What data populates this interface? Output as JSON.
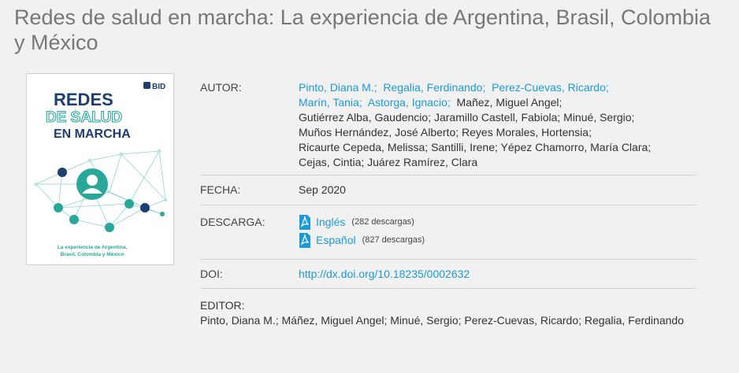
{
  "page": {
    "title": "Redes de salud en marcha: La experiencia de Argentina, Brasil, Colombia y México"
  },
  "cover": {
    "brand": "BID",
    "title_lines": [
      "REDES",
      "DE SALUD",
      "EN MARCHA"
    ],
    "subtitle_lines": [
      "La experiencia de Argentina,",
      "Brasil, Colombia y México"
    ],
    "colors": {
      "navy": "#1d3e6e",
      "teal": "#2aa79b",
      "network": "#8fd3cf"
    }
  },
  "autor": {
    "label": "AUTOR:",
    "linked": [
      "Pinto, Diana M.;",
      "Regalia, Ferdinando;",
      "Perez-Cuevas, Ricardo;",
      "Marín, Tania;",
      "Astorga, Ignacio;"
    ],
    "text_lines": [
      "Mañez, Miguel Angel;",
      "Gutiérrez Alba, Gaudencio;  Jaramillo Castell, Fabiola;  Minué, Sergio;",
      "Muños Hernández, José Alberto;  Reyes Morales, Hortensia;",
      "Ricaurte Cepeda, Melissa;  Santilli, Irene;  Yépez Chamorro, María Clara;",
      "Cejas, Cintia;  Juárez Ramírez, Clara"
    ]
  },
  "fecha": {
    "label": "FECHA:",
    "value": "Sep 2020"
  },
  "descarga": {
    "label": "DESCARGA:",
    "items": [
      {
        "lang": "Inglés",
        "count": "(282 descargas)"
      },
      {
        "lang": "Español",
        "count": "(827 descargas)"
      }
    ]
  },
  "doi": {
    "label": "DOI:",
    "value": "http://dx.doi.org/10.18235/0002632"
  },
  "editor": {
    "label": "EDITOR:",
    "value": "Pinto, Diana M.; Máñez, Miguel Angel; Minué, Sergio; Perez-Cuevas, Ricardo; Regalia, Ferdinando"
  },
  "colors": {
    "link": "#1c9ad6",
    "title": "#777777",
    "background": "#f1f1f1"
  }
}
